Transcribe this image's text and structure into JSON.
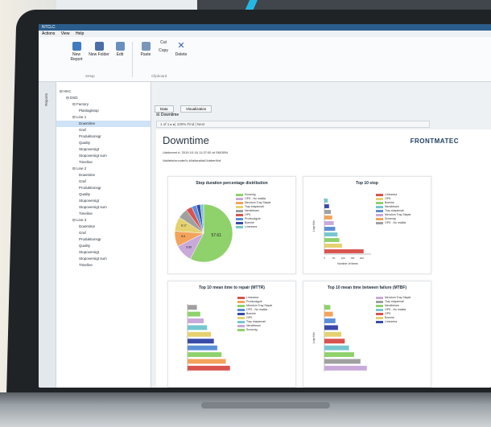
{
  "app": {
    "title": "NTCLC",
    "menu": [
      "Actions",
      "View",
      "Help"
    ],
    "side_tab": "Reports"
  },
  "ribbon": {
    "buttons": [
      {
        "label": "New Report",
        "icon": "new-report-icon"
      },
      {
        "label": "New Folder",
        "icon": "new-folder-icon"
      },
      {
        "label": "Edit",
        "icon": "edit-icon"
      },
      {
        "label": "Paste",
        "icon": "paste-icon"
      },
      {
        "label": "Copy",
        "icon": "copy-icon"
      },
      {
        "label": "Delete",
        "icon": "delete-icon"
      }
    ],
    "cut_label": "Cut",
    "groups": [
      "Setup",
      "Clipboard"
    ]
  },
  "tree": [
    {
      "label": "HKC",
      "level": 0
    },
    {
      "label": "DSD",
      "level": 1
    },
    {
      "label": "Factory",
      "level": 2
    },
    {
      "label": "Planlagtstop",
      "level": 3
    },
    {
      "label": "Line 1",
      "level": 2
    },
    {
      "label": "Downtime",
      "level": 3,
      "selected": true
    },
    {
      "label": "Graf",
      "level": 3
    },
    {
      "label": "Produktionsgr",
      "level": 3
    },
    {
      "label": "Quality",
      "level": 3
    },
    {
      "label": "Stopoversigt",
      "level": 3
    },
    {
      "label": "Stopoversigt sum",
      "level": 3
    },
    {
      "label": "Timeline",
      "level": 3
    },
    {
      "label": "Line 2",
      "level": 2
    },
    {
      "label": "Downtime",
      "level": 3
    },
    {
      "label": "Graf",
      "level": 3
    },
    {
      "label": "Produktionsgr",
      "level": 3
    },
    {
      "label": "Quality",
      "level": 3
    },
    {
      "label": "Stopoversigt",
      "level": 3
    },
    {
      "label": "Stopoversigt sum",
      "level": 3
    },
    {
      "label": "Timeline",
      "level": 3
    },
    {
      "label": "Line 3",
      "level": 2
    },
    {
      "label": "Downtime",
      "level": 3
    },
    {
      "label": "Graf",
      "level": 3
    },
    {
      "label": "Produktionsgr",
      "level": 3
    },
    {
      "label": "Quality",
      "level": 3
    },
    {
      "label": "Stopoversigt",
      "level": 3
    },
    {
      "label": "Stopoversigt sum",
      "level": 3
    },
    {
      "label": "Timeline",
      "level": 3
    }
  ],
  "main": {
    "tabs": [
      "Data",
      "Visualization"
    ],
    "report_checkbox_label": "Downtime",
    "toolbar_text": "1 of 1   ▸  ▸|   100%   Find | Next",
    "zoom": "100%",
    "doc_title": "Downtime",
    "brand": "FRONTMATEC",
    "meta_line1": "Udskrevet d. 2019-10-16 11:37:00 af SKIDBN",
    "meta_line2": "Valdeks/nrcode/Iv-kl/a/tara/tal/Jobbert/Iof"
  },
  "colors": {
    "titlebar": "#2b5d8c",
    "cable": "#25b7e3",
    "brand": "#1f3f63"
  },
  "chart_data": [
    {
      "type": "pie",
      "title": "Stop duration percentage distribution",
      "legend": [
        "Scrsenig",
        "OPS - No mailda",
        "Mendom Tray Staple",
        "Tray shapemail",
        "Nendbleam",
        "OPS",
        "Produudgyle",
        "Boeshe",
        "Limezeea"
      ],
      "values": [
        57.61,
        9.89,
        8.6,
        8.17,
        5.5,
        3.4,
        2.8,
        2.2,
        1.83
      ],
      "colors": [
        "#8fd16b",
        "#c9a9d9",
        "#f3a35b",
        "#e5d16f",
        "#a0a0a0",
        "#d9534f",
        "#5b8fd6",
        "#3a4aa8",
        "#76c6cf"
      ],
      "labels": [
        "57.61",
        "9.89",
        "8.6",
        "8.17"
      ]
    },
    {
      "type": "bar",
      "orientation": "horizontal",
      "title": "Top 10 stop",
      "ylabel": "Linje Nbr",
      "xlabel": "Number of times",
      "legend": [
        "Limezeea",
        "OPS",
        "Boeshe",
        "Nendbleam",
        "Tray shapemail",
        "Mendom Tray Staple",
        "Scrsenig",
        "OPS - No mailda"
      ],
      "values": [
        210,
        95,
        80,
        70,
        58,
        50,
        42,
        35,
        25,
        18
      ],
      "colors": [
        "#d9534f",
        "#e5d16f",
        "#8fd16b",
        "#76c6cf",
        "#5b8fd6",
        "#c9a9d9",
        "#f3a35b",
        "#a0a0a0",
        "#3a4aa8",
        "#76c6cf"
      ],
      "xticks": [
        "0",
        "50",
        "100",
        "150",
        "200"
      ],
      "xlim": [
        0,
        250
      ]
    },
    {
      "type": "bar",
      "orientation": "horizontal",
      "title": "Top 10 mean time to repair (MTTR)",
      "legend": [
        "Limezeea",
        "Produudgyle",
        "Mendom Tray Staple",
        "OPS - No mailda",
        "Boeshe",
        "OPS",
        "Tray shapemail",
        "Nendbleam",
        "Scrsenig"
      ],
      "values": [
        100,
        90,
        80,
        70,
        62,
        55,
        46,
        38,
        30,
        22
      ],
      "colors": [
        "#d9534f",
        "#f3a35b",
        "#8fd16b",
        "#5b8fd6",
        "#3a4aa8",
        "#e5d16f",
        "#76c6cf",
        "#c9a9d9",
        "#8fd16b",
        "#a0a0a0"
      ],
      "xlim": [
        0,
        110
      ]
    },
    {
      "type": "bar",
      "orientation": "horizontal",
      "title": "Top 10 mean time between failure (MTBF)",
      "ylabel": "Linje Nbr",
      "legend": [
        "Mendom Tray Staple",
        "Tray shapemail",
        "Nendbleam",
        "OPS - No mailda",
        "OPS",
        "Boeshe",
        "Limezeea"
      ],
      "values": [
        100,
        85,
        70,
        58,
        48,
        40,
        32,
        26,
        20,
        14
      ],
      "colors": [
        "#c9a9d9",
        "#a0a0a0",
        "#8fd16b",
        "#76c6cf",
        "#d9534f",
        "#e5d16f",
        "#3a4aa8",
        "#5b8fd6",
        "#f3a35b",
        "#8fd16b"
      ],
      "xlim": [
        0,
        110
      ]
    }
  ]
}
